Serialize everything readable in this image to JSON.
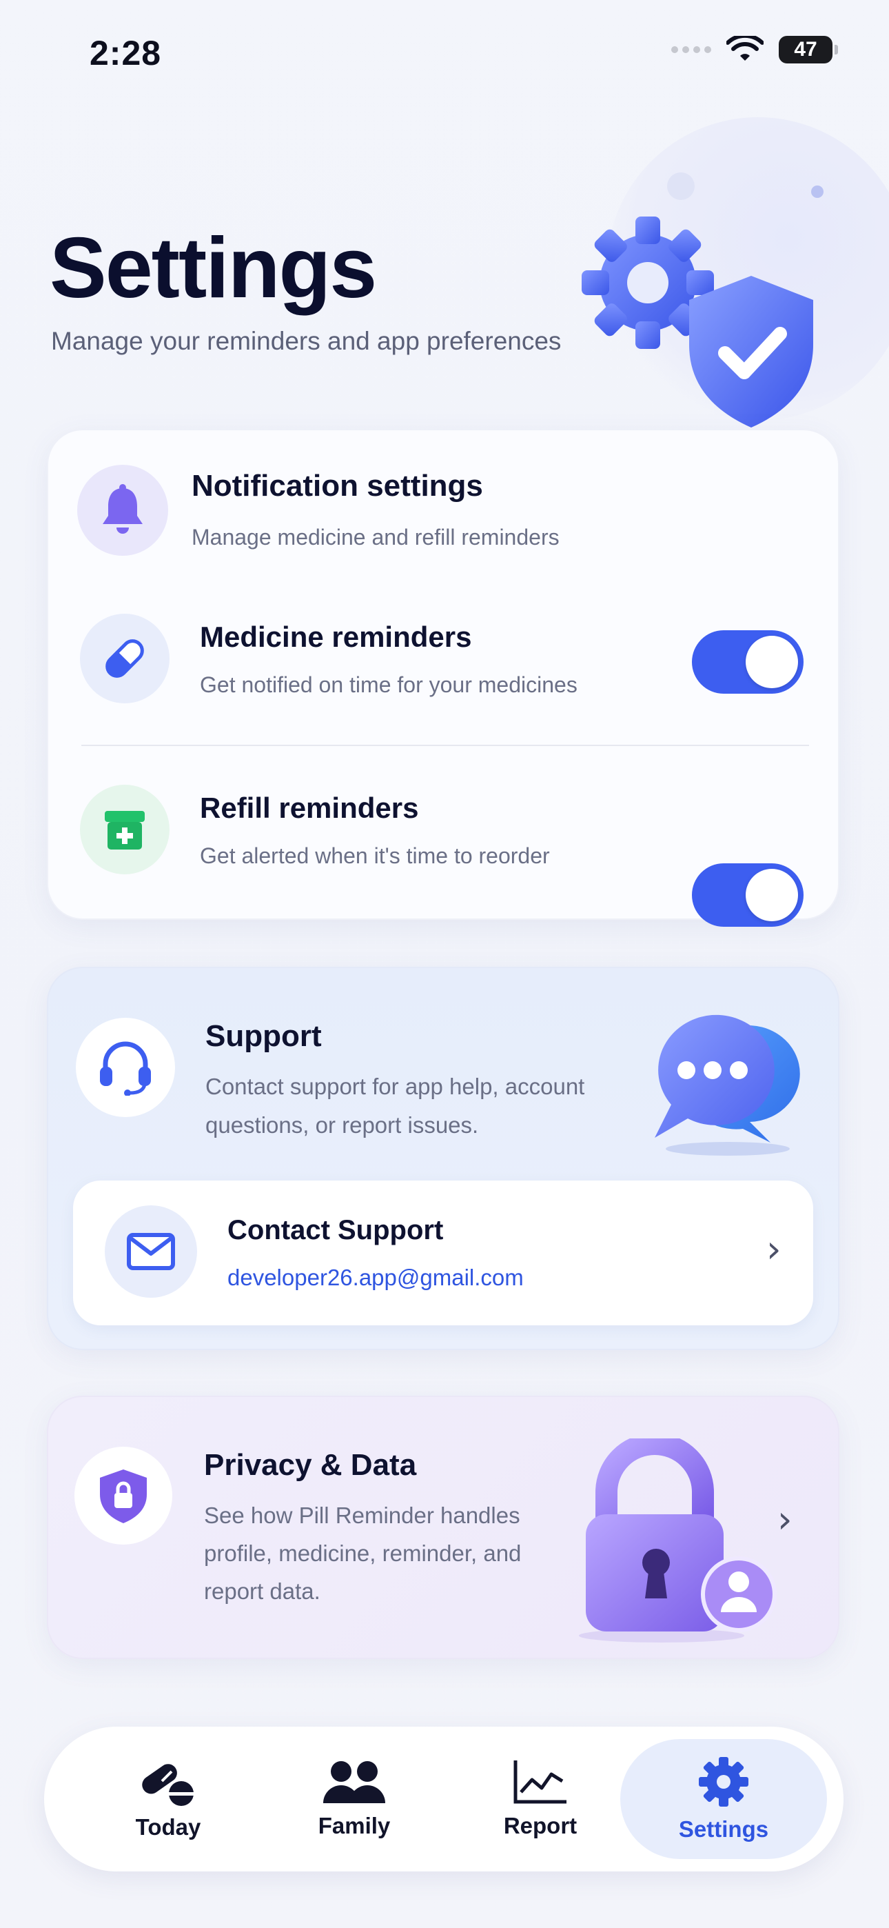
{
  "status_bar": {
    "time": "2:28",
    "battery": "47"
  },
  "header": {
    "title": "Settings",
    "subtitle": "Manage your reminders and app preferences"
  },
  "notifications": {
    "title": "Notification settings",
    "subtitle": "Manage medicine and refill reminders",
    "items": [
      {
        "title": "Medicine reminders",
        "desc": "Get notified on time for your medicines",
        "enabled": true
      },
      {
        "title": "Refill reminders",
        "desc": "Get alerted when it's time to reorder",
        "enabled": true
      }
    ]
  },
  "support": {
    "title": "Support",
    "desc_line1": "Contact support for app help, account",
    "desc_line2": "questions, or report issues.",
    "contact_title": "Contact Support",
    "contact_email": "developer26.app@gmail.com"
  },
  "privacy": {
    "title": "Privacy & Data",
    "desc_line1": "See how Pill Reminder handles",
    "desc_line2": "profile, medicine, reminder, and",
    "desc_line3": "report data."
  },
  "tabs": [
    {
      "label": "Today",
      "icon": "pills-icon"
    },
    {
      "label": "Family",
      "icon": "family-icon"
    },
    {
      "label": "Report",
      "icon": "chart-icon"
    },
    {
      "label": "Settings",
      "icon": "gear-icon",
      "active": true
    }
  ],
  "colors": {
    "accent": "#3d5ef0",
    "link": "#2f55e0",
    "title": "#0b0f2e",
    "refill_green": "#22c26b",
    "purple": "#7d5bea"
  }
}
